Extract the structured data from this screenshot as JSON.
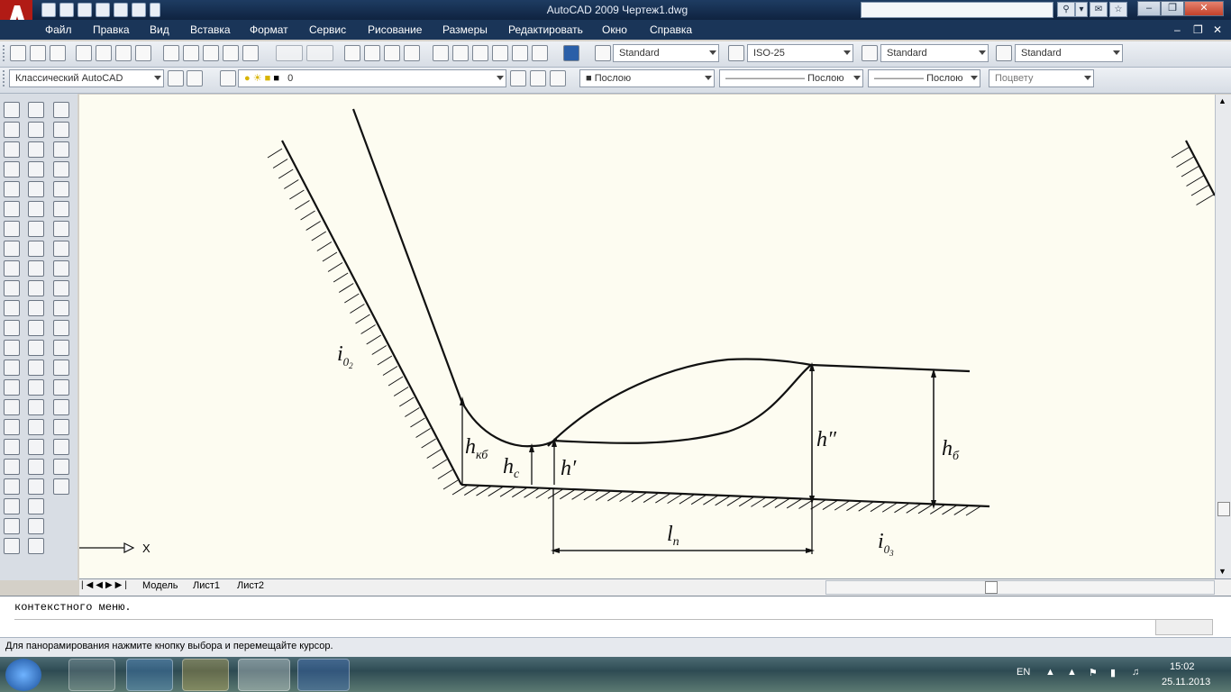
{
  "window": {
    "title": "AutoCAD 2009 Чертеж1.dwg"
  },
  "menu": [
    "Файл",
    "Правка",
    "Вид",
    "Вставка",
    "Формат",
    "Сервис",
    "Рисование",
    "Размеры",
    "Редактировать",
    "Окно",
    "Справка"
  ],
  "toolbar": {
    "text_style": "Standard",
    "dim_style": "ISO-25",
    "table_style": "Standard",
    "multileader_style": "Standard",
    "workspace": "Классический AutoCAD",
    "layer": "0",
    "color": "Послою",
    "linetype": "Послою",
    "lineweight": "Послою",
    "plotstyle": "Поцвету"
  },
  "drawing": {
    "labels": {
      "i02_base": "i",
      "i02_sub": "0",
      "i02_sub2": "2",
      "h_kb": "h",
      "h_kb_sub": "кб",
      "h_c": "h",
      "h_c_sub": "c",
      "h_prime": "h′",
      "h_dprime": "h″",
      "h_b": "h",
      "h_b_sub": "б",
      "l_n": "l",
      "l_n_sub": "п",
      "i03_base": "i",
      "i03_sub": "0",
      "i03_sub2": "3"
    },
    "ucs_x": "X",
    "colors": {
      "background": "#fdfcf1",
      "lines": "#111111"
    }
  },
  "layout_tabs": [
    "Модель",
    "Лист1",
    "Лист2"
  ],
  "command_line": {
    "history": "контекстного меню."
  },
  "status_bar": {
    "prompt": "Для панорамирования нажмите кнопку выбора и перемещайте курсор."
  },
  "taskbar": {
    "language": "EN",
    "time": "15:02",
    "date": "25.11.2013"
  }
}
